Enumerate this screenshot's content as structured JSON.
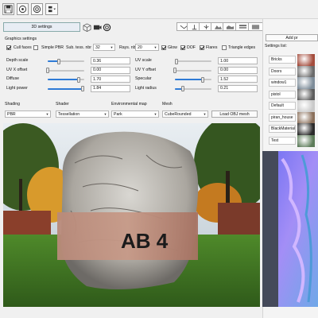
{
  "toolbar": {
    "icons": [
      "save-icon",
      "settings-icon",
      "gear-icon",
      "panel-dropdown-icon"
    ]
  },
  "tab_3d": "3D settings",
  "render_buttons": [
    "flat-view-icon",
    "up-arrow-icon",
    "tree-icon",
    "mountain-icon",
    "terrain-icon",
    "layers-icon"
  ],
  "right_panel": {
    "add_button": "Add pr",
    "settings_list_label": "Settings list:",
    "items": [
      "Bricks",
      "Doors",
      "window1",
      "pistol",
      "Default",
      "piran_house",
      "BlackMaterial",
      "Test"
    ]
  },
  "graphics": {
    "section_label": "Graphics settings",
    "cull_faces": {
      "label": "Cull faces",
      "checked": true
    },
    "simple_pbr": {
      "label": "Simple PBR",
      "checked": false
    },
    "sub_tess_label": "Sub. tess. nbr",
    "sub_tess_value": "32",
    "rays_label": "Rays. nbr",
    "rays_value": "20",
    "glow": {
      "label": "Glow",
      "checked": true
    },
    "dof": {
      "label": "DOF",
      "checked": true
    },
    "flares": {
      "label": "Flares",
      "checked": true
    },
    "triangle_edges": {
      "label": "Triangle edges",
      "checked": false
    }
  },
  "sliders_left": [
    {
      "label": "Depth scale",
      "value": "0.36",
      "fraction": 0.3
    },
    {
      "label": "UV X offset",
      "value": "0.00",
      "fraction": 0.0
    },
    {
      "label": "Diffuse",
      "value": "1.70",
      "fraction": 0.85
    },
    {
      "label": "Light power",
      "value": "1.84",
      "fraction": 0.95
    }
  ],
  "sliders_right": [
    {
      "label": "UV scale",
      "value": "1.00",
      "fraction": 0.05
    },
    {
      "label": "UV Y offset",
      "value": "0.00",
      "fraction": 0.0
    },
    {
      "label": "Specular",
      "value": "1.52",
      "fraction": 0.76
    },
    {
      "label": "Light radius",
      "value": "0.21",
      "fraction": 0.21
    }
  ],
  "dropdowns": {
    "shading_label": "Shading",
    "shading_value": "PBR",
    "shader_label": "Shader",
    "shader_value": "Tessellation",
    "env_label": "Environmental map",
    "env_value": "Park",
    "mesh_label": "Mesh",
    "mesh_value": "CubeRounded"
  },
  "load_obj_button": "Load OBJ mesh",
  "viewport": {
    "label_text": "AB 4"
  }
}
